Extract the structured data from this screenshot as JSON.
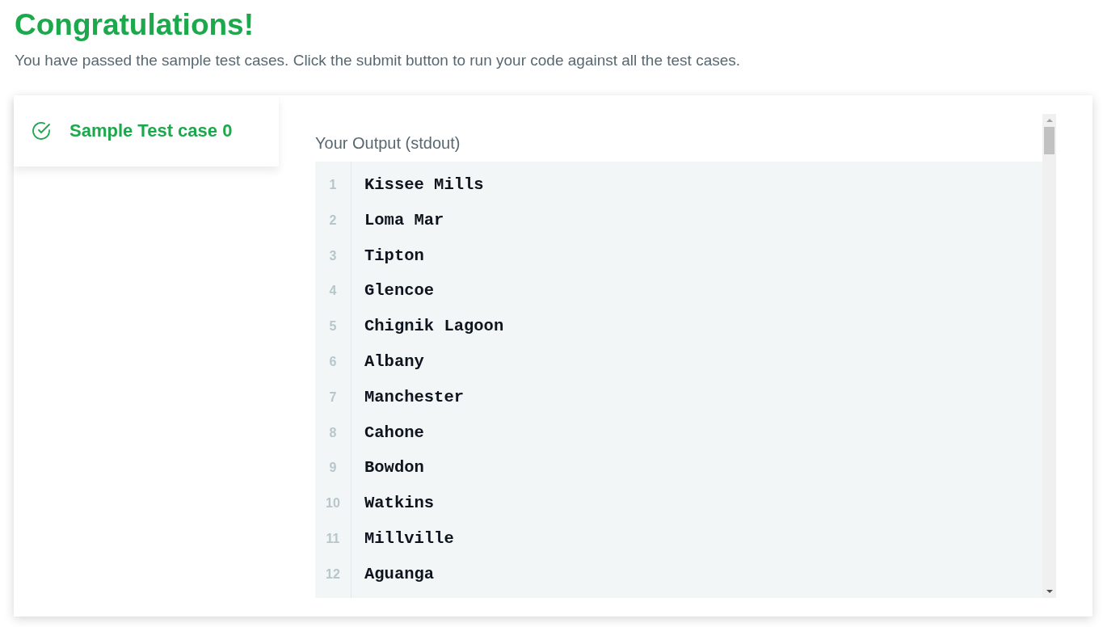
{
  "heading": "Congratulations!",
  "message": "You have passed the sample test cases. Click the submit button to run your code against all the test cases.",
  "test_cases": [
    {
      "label": "Sample Test case 0",
      "passed": true,
      "selected": true
    }
  ],
  "output": {
    "label": "Your Output (stdout)",
    "lines": [
      {
        "number": "1",
        "text": "Kissee Mills"
      },
      {
        "number": "2",
        "text": "Loma Mar"
      },
      {
        "number": "3",
        "text": "Tipton"
      },
      {
        "number": "4",
        "text": "Glencoe"
      },
      {
        "number": "5",
        "text": "Chignik Lagoon"
      },
      {
        "number": "6",
        "text": "Albany"
      },
      {
        "number": "7",
        "text": "Manchester"
      },
      {
        "number": "8",
        "text": "Cahone"
      },
      {
        "number": "9",
        "text": "Bowdon"
      },
      {
        "number": "10",
        "text": "Watkins"
      },
      {
        "number": "11",
        "text": "Millville"
      },
      {
        "number": "12",
        "text": "Aguanga"
      }
    ]
  }
}
